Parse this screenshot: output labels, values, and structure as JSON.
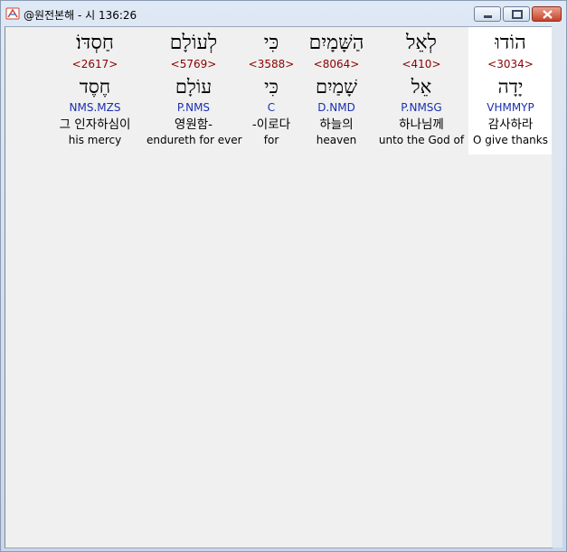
{
  "window": {
    "title": "@원전본해 - 시 136:26"
  },
  "columns": [
    {
      "hebrew": "הוֹדוּ",
      "strong": "<3034>",
      "lemma": "יָדָה",
      "morph": "VHMMYP",
      "korean": "감사하라",
      "english": "O give thanks",
      "selected": true
    },
    {
      "hebrew": "לְאֵל",
      "strong": "<410>",
      "lemma": "אֵל",
      "morph": "P.NMSG",
      "korean": "하나님께",
      "english": "unto the God of",
      "selected": false
    },
    {
      "hebrew": "הַשָּׁמָיִם",
      "strong": "<8064>",
      "lemma": "שָׁמַיִם",
      "morph": "D.NMD",
      "korean": "하늘의",
      "english": "heaven",
      "selected": false
    },
    {
      "hebrew": "כִּי",
      "strong": "<3588>",
      "lemma": "כִּי",
      "morph": "C",
      "korean": "-이로다",
      "english": "for",
      "selected": false
    },
    {
      "hebrew": "לְעוֹלָם",
      "strong": "<5769>",
      "lemma": "עוֹלָם",
      "morph": "P.NMS",
      "korean": "영원함-",
      "english": "endureth for ever",
      "selected": false
    },
    {
      "hebrew": "חַסְדּוֹ׃",
      "strong": "<2617>",
      "lemma": "חֶסֶד",
      "morph": "NMS.MZS",
      "korean": "그 인자하심이",
      "english": "his mercy",
      "selected": false
    }
  ],
  "colors": {
    "strong": "#8b0000",
    "morph": "#1a2fb0",
    "selected_bg": "#ffffff",
    "client_bg": "#f0f0f0"
  }
}
